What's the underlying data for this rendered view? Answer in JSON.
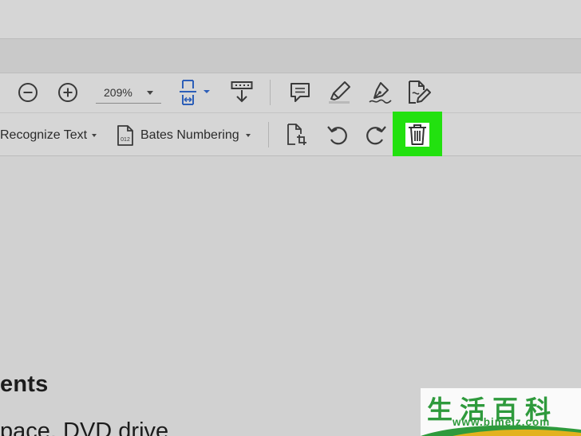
{
  "toolbar1": {
    "zoom_out_icon": "minus-circle-icon",
    "zoom_in_icon": "plus-circle-icon",
    "zoom_value": "209%",
    "fit_icon": "fit-page-icon",
    "scroll_mode_icon": "scroll-mode-icon",
    "comment_icon": "comment-icon",
    "highlight_icon": "highlighter-icon",
    "draw_icon": "pen-nib-icon",
    "sign_icon": "fill-sign-icon"
  },
  "toolbar2": {
    "recognize_text_label": "Recognize Text",
    "bates_numbering_label": "Bates Numbering",
    "bates_icon_text": "012",
    "crop_icon": "crop-page-icon",
    "rotate_left_icon": "rotate-counterclockwise-icon",
    "rotate_right_icon": "rotate-clockwise-icon",
    "delete_icon": "trash-icon"
  },
  "document": {
    "heading_fragment": "ents",
    "body_fragment": "pace, DVD drive"
  },
  "watermark": {
    "cjk": "生活百科",
    "url": "www.bimeiz.com"
  },
  "colors": {
    "highlight": "#22e10f",
    "fit_icon_blue": "#2d5fb8",
    "watermark_green": "#2e9a3c"
  }
}
